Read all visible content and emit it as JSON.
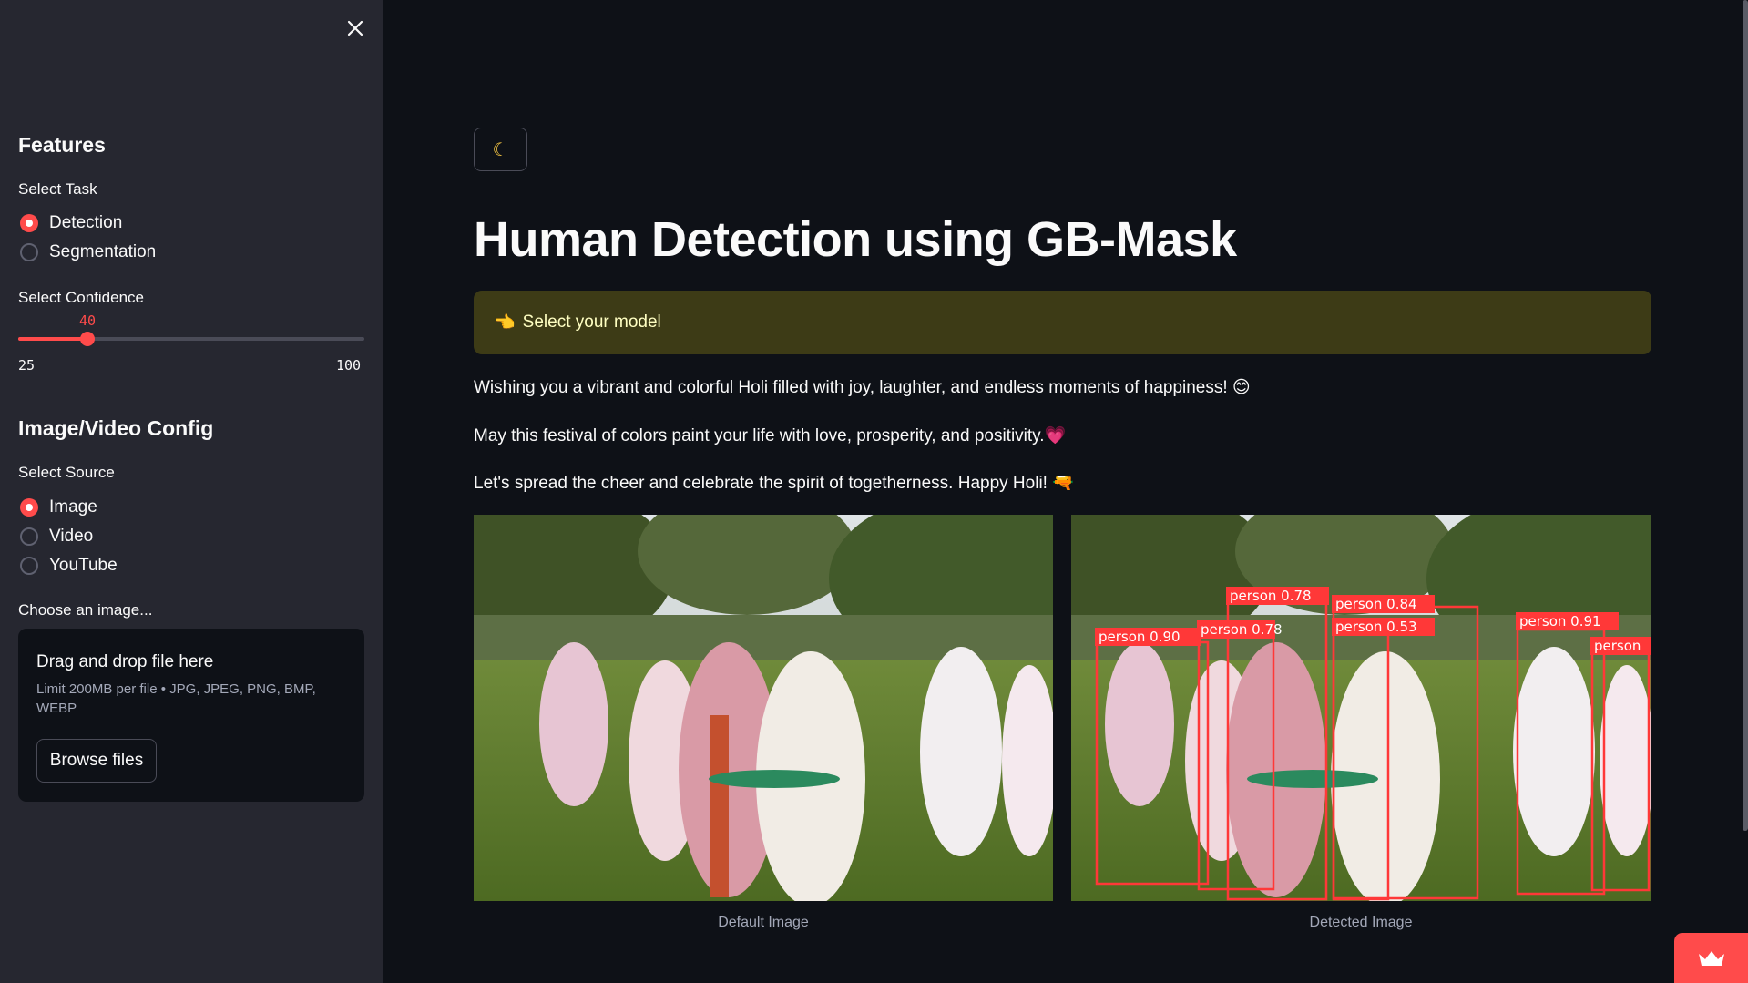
{
  "sidebar": {
    "features_heading": "Features",
    "task_label": "Select Task",
    "task_options": [
      "Detection",
      "Segmentation"
    ],
    "task_selected": "Detection",
    "confidence_label": "Select Confidence",
    "confidence": {
      "value": "40",
      "min": "25",
      "max": "100"
    },
    "config_heading": "Image/Video Config",
    "source_label": "Select Source",
    "source_options": [
      "Image",
      "Video",
      "YouTube"
    ],
    "source_selected": "Image",
    "uploader_label": "Choose an image...",
    "uploader": {
      "title": "Drag and drop file here",
      "limit": "Limit 200MB per file • JPG, JPEG, PNG, BMP, WEBP",
      "button": "Browse files"
    }
  },
  "main": {
    "title": "Human Detection using GB-Mask",
    "info": {
      "icon": "👈",
      "text": "Select your model"
    },
    "paragraphs": [
      "Wishing you a vibrant and colorful Holi filled with joy, laughter, and endless moments of happiness! 😊",
      "May this festival of colors paint your life with love, prosperity, and positivity.💗",
      "Let's spread the cheer and celebrate the spirit of togetherness. Happy Holi! 🔫"
    ],
    "images": {
      "default_caption": "Default Image",
      "detected_caption": "Detected Image"
    },
    "detections": [
      {
        "label": "person 0.90"
      },
      {
        "label": "person 0.78"
      },
      {
        "label": "person 0.78"
      },
      {
        "label": "person 0.84"
      },
      {
        "label": "person 0.53"
      },
      {
        "label": "person 0.91"
      },
      {
        "label": "person"
      }
    ]
  },
  "colors": {
    "background": "#0e1117",
    "sidebar": "#262730",
    "accent": "#ff4b4b",
    "info_bg": "#3d3b16",
    "info_text": "#ffffc2"
  },
  "icons": [
    "close-icon",
    "moon-icon",
    "pointing-hand-icon",
    "crown-icon"
  ]
}
